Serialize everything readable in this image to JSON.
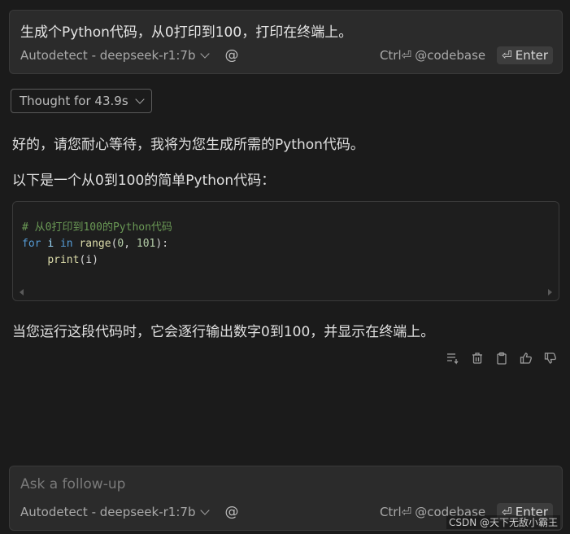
{
  "prompt": {
    "text": "生成个Python代码，从0打印到100，打印在终端上。"
  },
  "toolbar": {
    "model": "Autodetect - deepseek-r1:7b",
    "at_symbol": "@",
    "ctrl_label": "Ctrl⏎",
    "codebase_label": "@codebase",
    "enter_label": "Enter",
    "enter_glyph": "⏎"
  },
  "thought": {
    "label": "Thought for 43.9s"
  },
  "response": {
    "intro": "好的，请您耐心等待，我将为您生成所需的Python代码。",
    "lead": "以下是一个从0到100的简单Python代码：",
    "code": {
      "comment": "# 从0打印到100的Python代码",
      "kw_for": "for",
      "var_i": "i",
      "kw_in": "in",
      "fn_range": "range",
      "paren_open": "(",
      "num_start": "0",
      "comma": ", ",
      "num_end": "101",
      "paren_close": "):",
      "indent": "    ",
      "fn_print": "print",
      "print_args": "(i)"
    },
    "outro": "当您运行这段代码时，它会逐行输出数字0到100，并显示在终端上。"
  },
  "followup": {
    "placeholder": "Ask a follow-up"
  },
  "watermark": "CSDN @天下无敌小霸王",
  "icons": [
    "insert-list-icon",
    "trash-icon",
    "clipboard-icon",
    "thumbs-up-icon",
    "thumbs-down-icon"
  ]
}
